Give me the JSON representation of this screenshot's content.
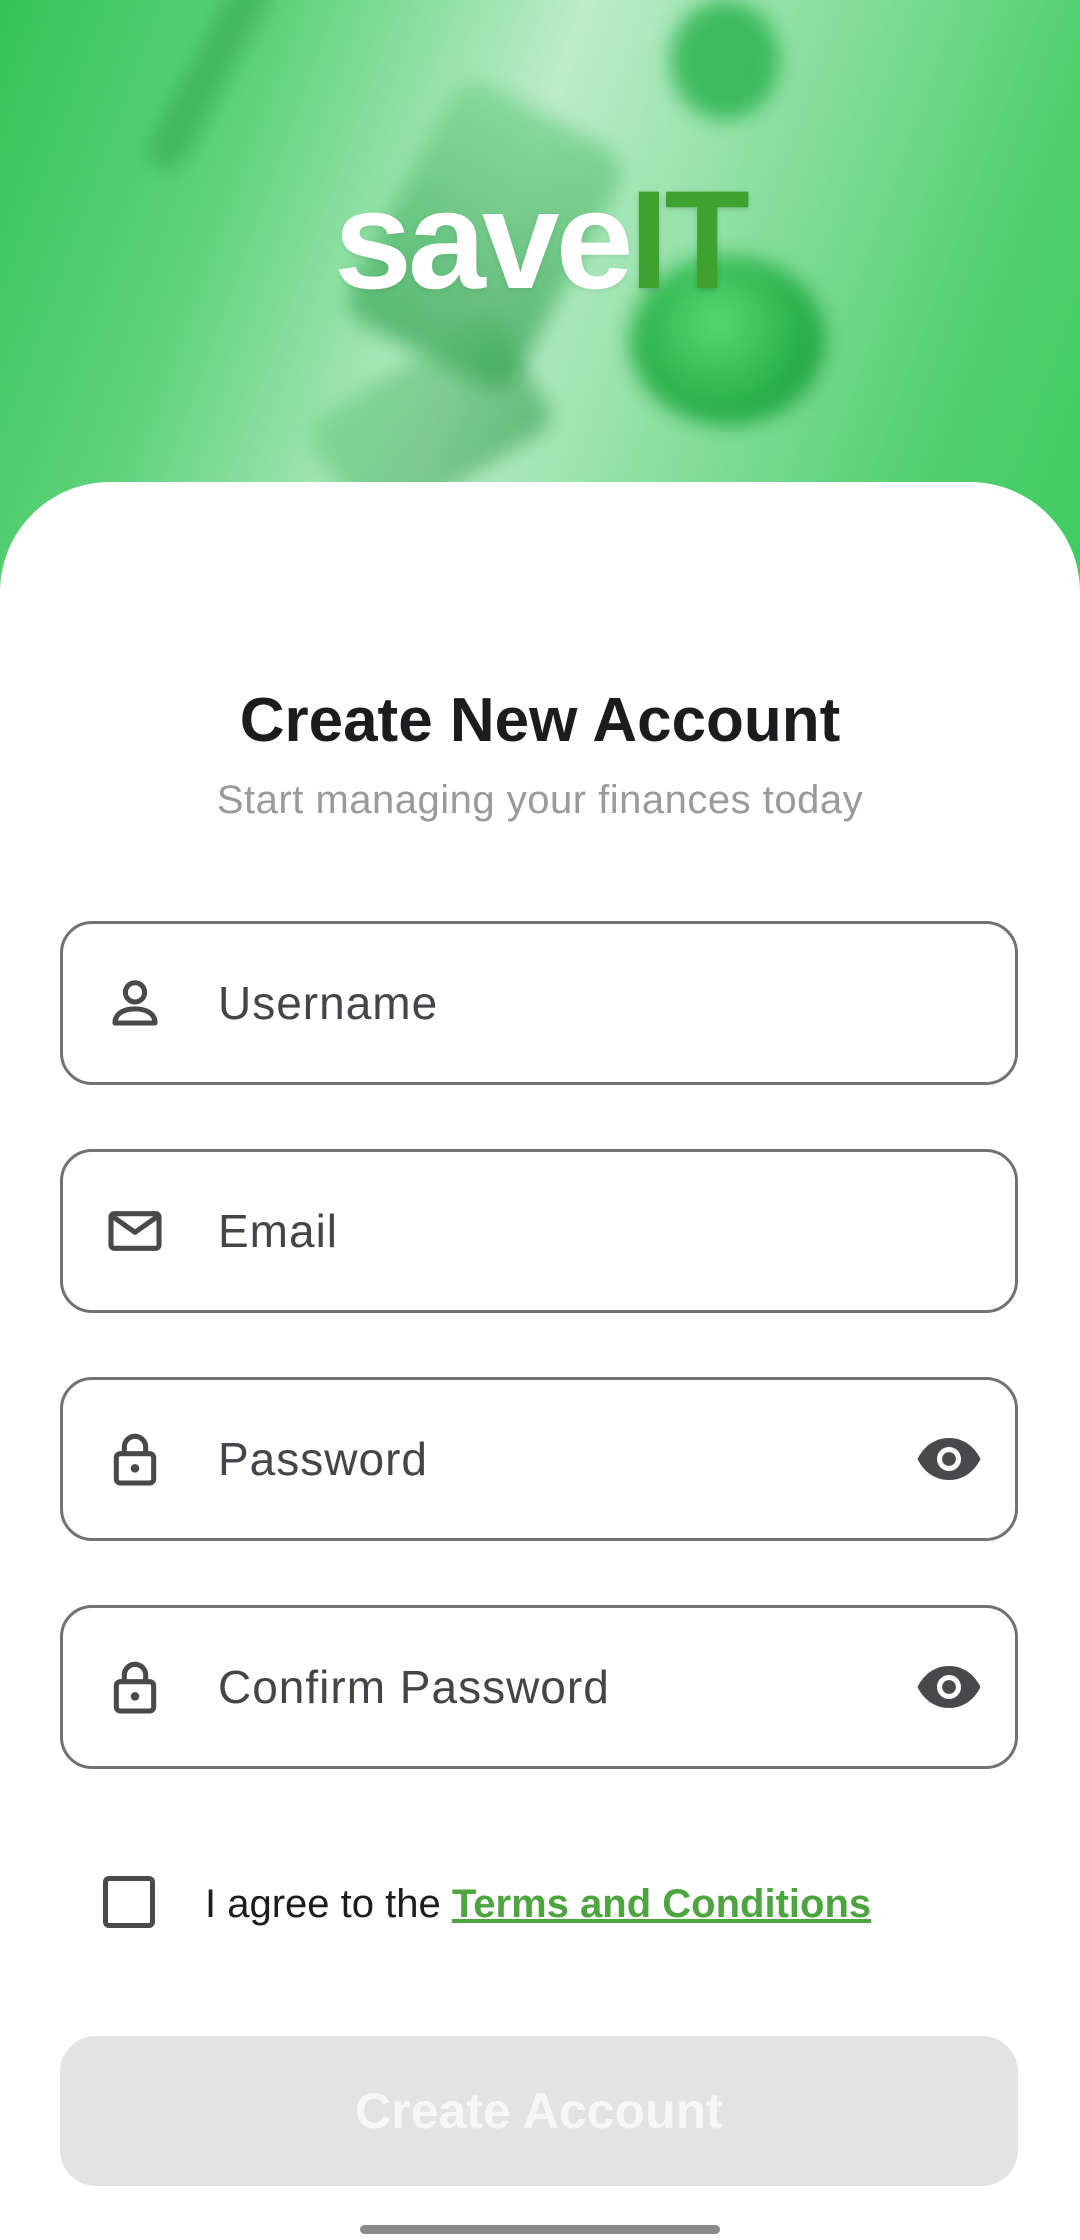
{
  "brand": {
    "logo_part1": "save",
    "logo_part2": "IT",
    "logo_part1_color": "#ffffff",
    "logo_part2_color": "#3ea22f"
  },
  "header": {
    "title": "Create New Account",
    "subtitle": "Start managing your finances today"
  },
  "form": {
    "fields": [
      {
        "name": "username",
        "icon": "person-icon",
        "placeholder": "Username",
        "value": ""
      },
      {
        "name": "email",
        "icon": "mail-icon",
        "placeholder": "Email",
        "value": ""
      },
      {
        "name": "password",
        "icon": "lock-icon",
        "placeholder": "Password",
        "value": "",
        "trailing_icon": "eye-icon"
      },
      {
        "name": "confirm_password",
        "icon": "lock-icon",
        "placeholder": "Confirm Password",
        "value": "",
        "trailing_icon": "eye-icon"
      }
    ],
    "agree_prefix": "I agree to the ",
    "terms_link": "Terms and Conditions",
    "agree_checked": false,
    "submit_label": "Create Account",
    "submit_enabled": false
  },
  "colors": {
    "accent": "#4da53f",
    "hero_green": "#3fcc62",
    "button_disabled": "#e3e3e3"
  }
}
